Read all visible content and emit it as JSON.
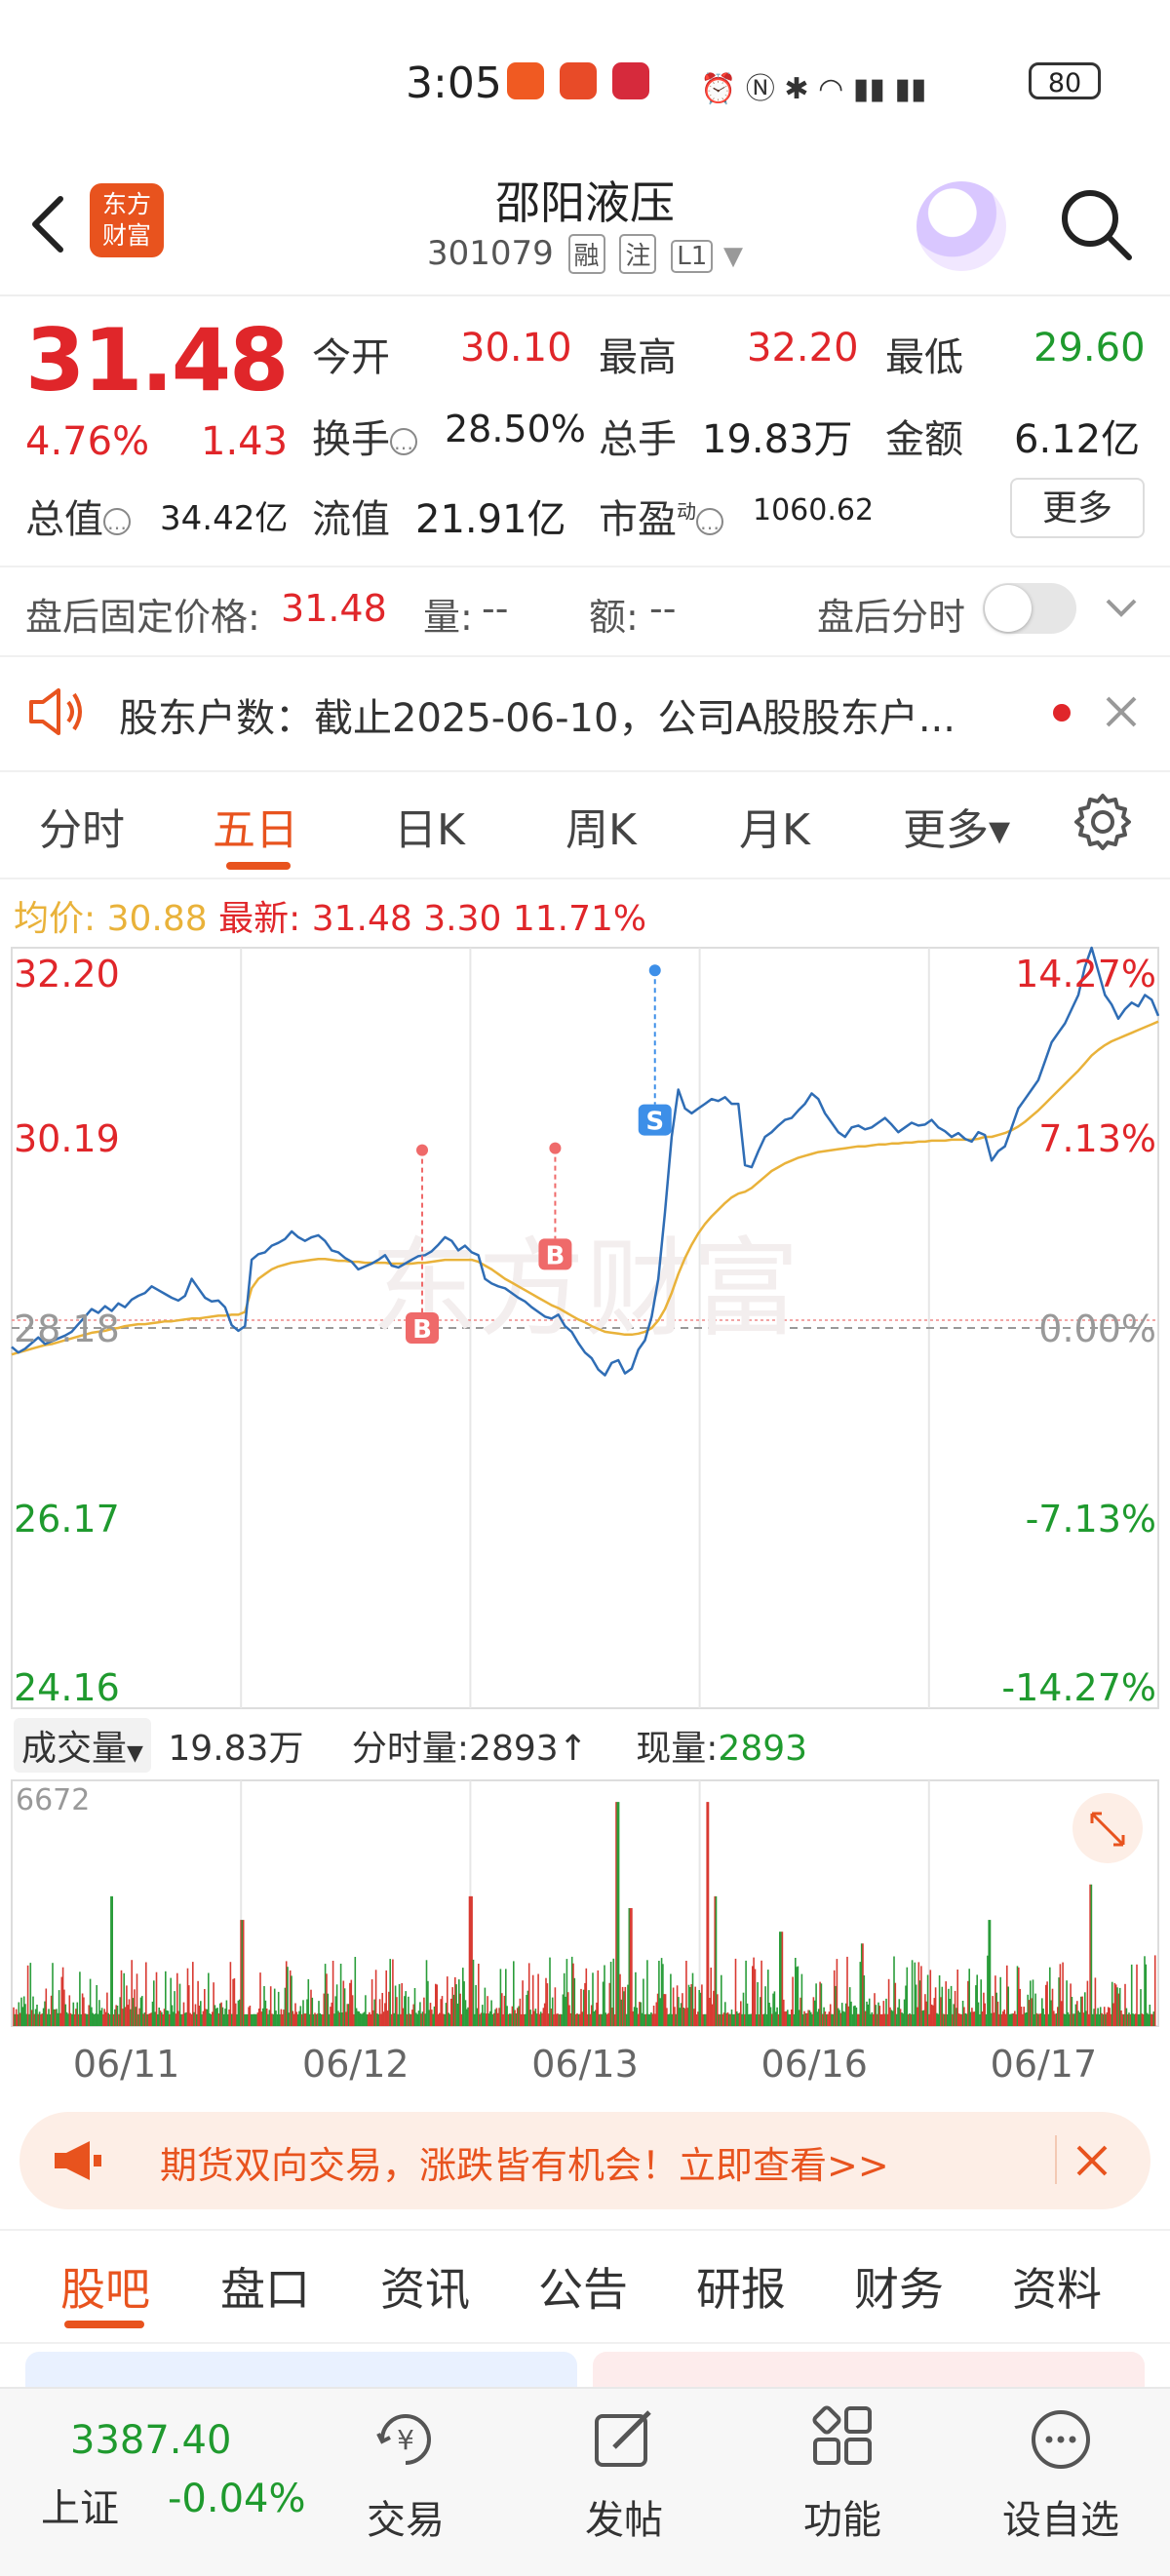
{
  "status_bar": {
    "time": "3:05",
    "battery": "80"
  },
  "header": {
    "logo_text_1": "东方",
    "logo_text_2": "财富",
    "stock_name": "邵阳液压",
    "stock_code": "301079",
    "tags": [
      "融",
      "注",
      "L1"
    ]
  },
  "quote": {
    "price": "31.48",
    "change_pct": "4.76%",
    "change": "1.43",
    "open_label": "今开",
    "open": "30.10",
    "high_label": "最高",
    "high": "32.20",
    "low_label": "最低",
    "low": "29.60",
    "turnover_label": "换手",
    "turnover": "28.50%",
    "volume_label": "总手",
    "volume": "19.83万",
    "amount_label": "金额",
    "amount": "6.12亿",
    "mktcap_label": "总值",
    "mktcap": "34.42亿",
    "float_label": "流值",
    "float": "21.91亿",
    "pe_label": "市盈",
    "pe_sup": "动",
    "pe": "1060.62",
    "more_label": "更多"
  },
  "after_hours": {
    "label": "盘后固定价格:",
    "price": "31.48",
    "vol_label": "量:",
    "vol": "--",
    "amt_label": "额:",
    "amt": "--",
    "toggle_label": "盘后分时"
  },
  "news": {
    "text": "股东户数：截止2025-06-10，公司A股股东户..."
  },
  "chart_tabs": [
    "分时",
    "五日",
    "日K",
    "周K",
    "月K",
    "更多▾"
  ],
  "avg_row": {
    "avg_label": "均价:",
    "avg": "30.88",
    "latest_label": "最新:",
    "latest": "31.48",
    "chg": "3.30",
    "pct": "11.71%"
  },
  "volume_row": {
    "selector": "成交量",
    "total": "19.83万",
    "tick_label": "分时量:",
    "tick": "2893↑",
    "now_label": "现量:",
    "now": "2893"
  },
  "ad": {
    "text": "期货双向交易，涨跌皆有机会！立即查看>>"
  },
  "bottom_tabs": [
    "股吧",
    "盘口",
    "资讯",
    "公告",
    "研报",
    "财务",
    "资料"
  ],
  "bottom_nav": {
    "index_value": "3387.40",
    "index_name": "上证",
    "index_change": "-0.04%",
    "items": [
      "交易",
      "发帖",
      "功能",
      "设自选"
    ]
  },
  "colors": {
    "up": "#e0262a",
    "down": "#1f9a2e",
    "accent": "#e8531e",
    "price_line": "#2f6db5",
    "avg_line": "#e9b23a"
  },
  "chart_data": {
    "type": "line",
    "title": "",
    "x_labels": [
      "06/11",
      "06/12",
      "06/13",
      "06/16",
      "06/17"
    ],
    "y_left_ticks": [
      "32.20",
      "30.19",
      "28.18",
      "26.17",
      "24.16"
    ],
    "y_right_ticks": [
      "14.27%",
      "7.13%",
      "0.00%",
      "-7.13%",
      "-14.27%"
    ],
    "ylim": [
      24.16,
      32.2
    ],
    "prev_close": 28.18,
    "series": [
      {
        "name": "",
        "values": [
          27.98,
          27.92,
          27.96,
          28.02,
          28.08,
          28.01,
          28.04,
          28.07,
          28.1,
          28.14,
          28.22,
          28.3,
          28.38,
          28.34,
          28.41,
          28.36,
          28.44,
          28.4,
          28.48,
          28.52,
          28.55,
          28.62,
          28.58,
          28.54,
          28.5,
          28.47,
          28.52,
          28.7,
          28.6,
          28.5,
          28.46,
          28.47,
          28.4,
          28.21,
          28.15,
          28.2,
          28.9,
          28.96,
          28.98,
          29.05,
          29.08,
          29.12,
          29.2,
          29.14,
          29.1,
          29.14,
          29.16,
          29.1,
          29.0,
          28.98,
          28.92,
          28.88,
          28.8,
          28.83,
          28.86,
          28.9,
          28.95,
          28.84,
          28.82,
          28.86,
          28.9,
          28.94,
          28.95,
          28.99,
          29.06,
          29.14,
          29.1,
          29.0,
          29.05,
          28.98,
          28.95,
          28.7,
          28.65,
          28.62,
          28.6,
          28.55,
          28.5,
          28.46,
          28.4,
          28.35,
          28.3,
          28.28,
          28.32,
          28.2,
          28.14,
          28.02,
          27.92,
          27.86,
          27.74,
          27.68,
          27.81,
          27.84,
          27.7,
          27.75,
          27.95,
          28.05,
          28.3,
          28.7,
          29.4,
          30.2,
          30.7,
          30.5,
          30.45,
          30.5,
          30.55,
          30.6,
          30.58,
          30.62,
          30.55,
          30.55,
          29.9,
          29.88,
          30.05,
          30.2,
          30.25,
          30.32,
          30.38,
          30.4,
          30.48,
          30.55,
          30.66,
          30.6,
          30.45,
          30.35,
          30.25,
          30.2,
          30.3,
          30.32,
          30.28,
          30.3,
          30.35,
          30.4,
          30.33,
          30.25,
          30.3,
          30.35,
          30.32,
          30.33,
          30.38,
          30.3,
          30.26,
          30.2,
          30.24,
          30.18,
          30.15,
          30.25,
          30.22,
          29.95,
          30.05,
          30.1,
          30.3,
          30.5,
          30.6,
          30.7,
          30.8,
          31.0,
          31.2,
          31.3,
          31.4,
          31.55,
          31.7,
          32.0,
          32.2,
          31.95,
          31.7,
          31.6,
          31.45,
          31.55,
          31.62,
          31.58,
          31.7,
          31.65,
          31.48
        ]
      },
      {
        "name": "",
        "values": [
          27.9,
          27.92,
          27.94,
          27.96,
          27.98,
          28.0,
          28.01,
          28.03,
          28.05,
          28.07,
          28.09,
          28.11,
          28.13,
          28.14,
          28.15,
          28.17,
          28.18,
          28.2,
          28.21,
          28.22,
          28.22,
          28.23,
          28.24,
          28.25,
          28.25,
          28.26,
          28.27,
          28.28,
          28.28,
          28.29,
          28.3,
          28.31,
          28.31,
          28.32,
          28.32,
          28.35,
          28.6,
          28.7,
          28.75,
          28.8,
          28.83,
          28.85,
          28.87,
          28.88,
          28.89,
          28.9,
          28.91,
          28.91,
          28.9,
          28.89,
          28.89,
          28.88,
          28.88,
          28.87,
          28.87,
          28.87,
          28.87,
          28.86,
          28.86,
          28.86,
          28.86,
          28.87,
          28.87,
          28.88,
          28.89,
          28.9,
          28.9,
          28.9,
          28.9,
          28.9,
          28.88,
          28.84,
          28.8,
          28.75,
          28.7,
          28.66,
          28.62,
          28.58,
          28.54,
          28.5,
          28.46,
          28.42,
          28.39,
          28.35,
          28.31,
          28.27,
          28.24,
          28.2,
          28.17,
          28.14,
          28.13,
          28.12,
          28.11,
          28.11,
          28.12,
          28.14,
          28.18,
          28.26,
          28.38,
          28.55,
          28.75,
          28.92,
          29.06,
          29.18,
          29.28,
          29.36,
          29.43,
          29.5,
          29.56,
          29.6,
          29.62,
          29.66,
          29.72,
          29.78,
          29.84,
          29.88,
          29.92,
          29.95,
          29.98,
          30.0,
          30.02,
          30.04,
          30.05,
          30.06,
          30.07,
          30.08,
          30.09,
          30.1,
          30.1,
          30.11,
          30.12,
          30.12,
          30.13,
          30.13,
          30.14,
          30.14,
          30.15,
          30.15,
          30.16,
          30.16,
          30.16,
          30.17,
          30.17,
          30.17,
          30.17,
          30.18,
          30.2,
          30.2,
          30.22,
          30.24,
          30.27,
          30.31,
          30.36,
          30.42,
          30.48,
          30.55,
          30.62,
          30.69,
          30.76,
          30.83,
          30.9,
          30.98,
          31.06,
          31.12,
          31.17,
          31.21,
          31.24,
          31.27,
          31.3,
          31.33,
          31.36,
          31.39,
          31.42
        ]
      }
    ],
    "trade_marks": [
      "B",
      "B",
      "S"
    ],
    "volume": {
      "max_label": "6672"
    },
    "grid": true
  }
}
